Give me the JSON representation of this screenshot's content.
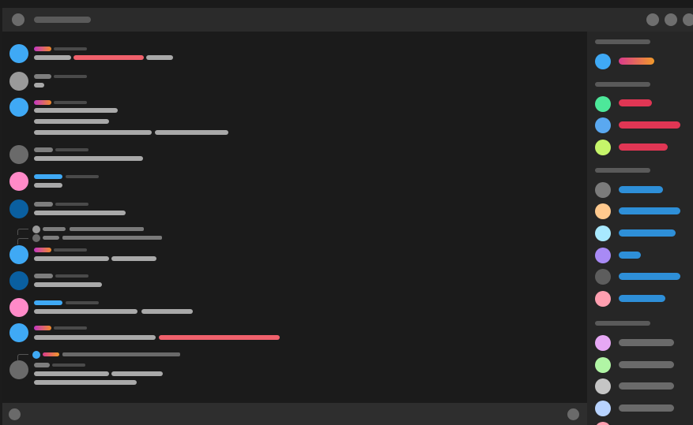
{
  "window": {
    "title": "",
    "controls": [
      "minimize-button",
      "maximize-button",
      "close-button"
    ]
  },
  "colors": {
    "background": "#1b1b1b",
    "titlebar": "#2b2b2b",
    "sidebar": "#262626",
    "composer": "#2e2e2e",
    "mention_red": "#f0616c",
    "link_blue": "#3fa9f5",
    "text_placeholder": "#a9a9a9"
  },
  "messages": [
    {
      "avatar_color": "#3fa9f5",
      "name_style": "gradient"
    },
    {
      "avatar_color": "#9a9a9a",
      "name_style": "gray"
    },
    {
      "avatar_color": "#3fa9f5",
      "name_style": "gradient"
    },
    {
      "avatar_color": "#6a6a6a",
      "name_style": "gray"
    },
    {
      "avatar_color": "#ff8ac8",
      "name_style": "blue"
    },
    {
      "avatar_color": "#0a5fa0",
      "name_style": "gray"
    },
    {
      "avatar_color": "#3fa9f5",
      "name_style": "gradient"
    },
    {
      "avatar_color": "#0a5fa0",
      "name_style": "gray"
    },
    {
      "avatar_color": "#ff8ac8",
      "name_style": "blue"
    },
    {
      "avatar_color": "#3fa9f5",
      "name_style": "gradient"
    },
    {
      "avatar_color": "#6a6a6a",
      "name_style": "gray"
    }
  ],
  "members": {
    "sections": [
      {
        "members": [
          {
            "avatar_color": "#3fa9f5",
            "name_style": "gradient"
          }
        ]
      },
      {
        "members": [
          {
            "avatar_color": "#4de89a",
            "name_style": "red"
          },
          {
            "avatar_color": "#5aa8f0",
            "name_style": "red"
          },
          {
            "avatar_color": "#c6f56a",
            "name_style": "red"
          }
        ]
      },
      {
        "members": [
          {
            "avatar_color": "#7b7b7b",
            "name_style": "blue"
          },
          {
            "avatar_color": "#ffc98e",
            "name_style": "blue"
          },
          {
            "avatar_color": "#a8e9ff",
            "name_style": "blue"
          },
          {
            "avatar_color": "#a88af5",
            "name_style": "blue"
          },
          {
            "avatar_color": "#5d5d5d",
            "name_style": "blue"
          },
          {
            "avatar_color": "#ff9fb0",
            "name_style": "blue"
          }
        ]
      },
      {
        "members": [
          {
            "avatar_color": "#e7a8f5",
            "name_style": "gray"
          },
          {
            "avatar_color": "#b1f5a5",
            "name_style": "gray"
          },
          {
            "avatar_color": "#c5c5c5",
            "name_style": "gray"
          },
          {
            "avatar_color": "#b8d3ff",
            "name_style": "gray"
          }
        ]
      }
    ]
  },
  "composer": {
    "input_placeholder": ""
  }
}
